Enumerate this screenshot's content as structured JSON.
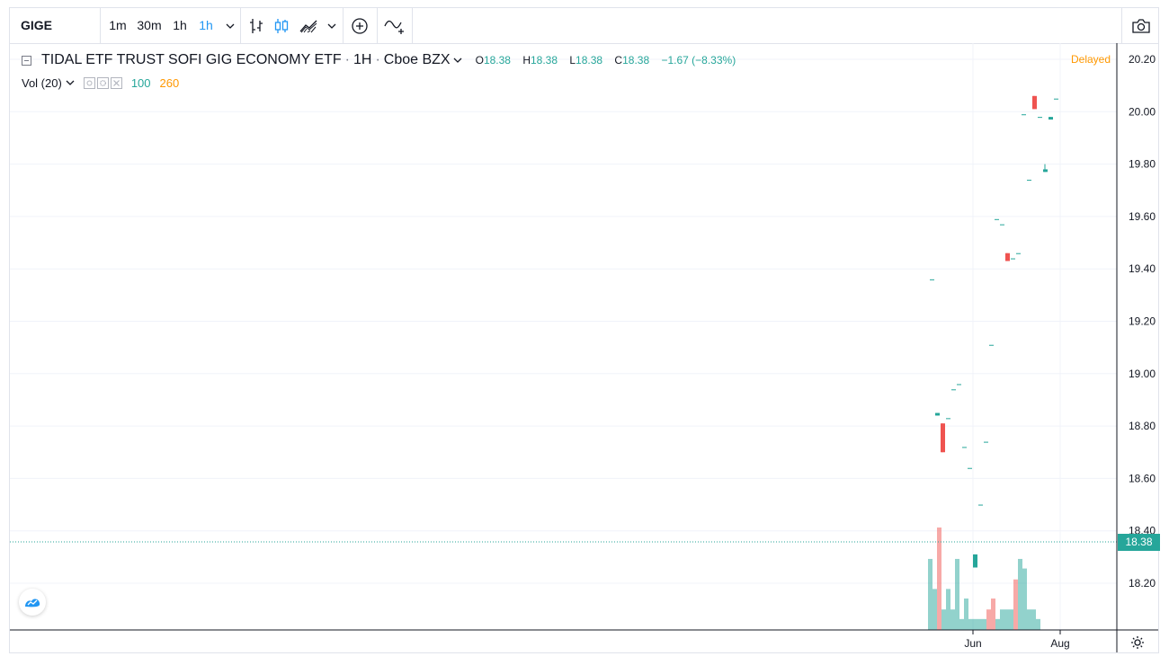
{
  "toolbar": {
    "symbol": "GIGE",
    "intervals": [
      "1m",
      "30m",
      "1h",
      "1h"
    ],
    "active_interval_index": 3
  },
  "legend": {
    "title": "TIDAL ETF TRUST SOFI GIG ECONOMY ETF",
    "interval": "1H",
    "exchange": "Cboe BZX",
    "o_label": "O",
    "o_value": "18.38",
    "h_label": "H",
    "h_value": "18.38",
    "l_label": "L",
    "l_value": "18.38",
    "c_label": "C",
    "c_value": "18.38",
    "change": "−1.67 (−8.33%)"
  },
  "volume_legend": {
    "label": "Vol (20)",
    "value_1": "100",
    "value_2": "260"
  },
  "status": "Delayed",
  "last_price": "18.38",
  "colors": {
    "up": "#26a69a",
    "down": "#ef5350",
    "accent": "#2196f3",
    "delayed": "#ff9800"
  },
  "chart_data": {
    "type": "candlestick",
    "y_ticks": [
      "20.20",
      "20.00",
      "19.80",
      "19.60",
      "19.40",
      "19.20",
      "19.00",
      "18.80",
      "18.60",
      "18.40",
      "18.20"
    ],
    "x_ticks": [
      "Jun",
      "Aug"
    ],
    "ylim": [
      18.05,
      20.25
    ],
    "grid": true,
    "candles": [
      {
        "o": 19.36,
        "c": 19.36,
        "h": 19.36,
        "l": 19.36
      },
      {
        "o": 18.84,
        "c": 18.85,
        "h": 18.85,
        "l": 18.84
      },
      {
        "o": 18.81,
        "c": 18.7,
        "h": 18.81,
        "l": 18.7
      },
      {
        "o": 18.83,
        "c": 18.83,
        "h": 18.83,
        "l": 18.83
      },
      {
        "o": 18.94,
        "c": 18.94,
        "h": 18.94,
        "l": 18.94
      },
      {
        "o": 18.96,
        "c": 18.96,
        "h": 18.96,
        "l": 18.96
      },
      {
        "o": 18.72,
        "c": 18.72,
        "h": 18.72,
        "l": 18.72
      },
      {
        "o": 18.64,
        "c": 18.64,
        "h": 18.64,
        "l": 18.64
      },
      {
        "o": 18.26,
        "c": 18.31,
        "h": 18.31,
        "l": 18.26
      },
      {
        "o": 18.5,
        "c": 18.5,
        "h": 18.5,
        "l": 18.5
      },
      {
        "o": 18.74,
        "c": 18.74,
        "h": 18.74,
        "l": 18.74
      },
      {
        "o": 19.11,
        "c": 19.11,
        "h": 19.11,
        "l": 19.11
      },
      {
        "o": 19.59,
        "c": 19.59,
        "h": 19.59,
        "l": 19.59
      },
      {
        "o": 19.57,
        "c": 19.57,
        "h": 19.57,
        "l": 19.57
      },
      {
        "o": 19.46,
        "c": 19.43,
        "h": 19.46,
        "l": 19.43
      },
      {
        "o": 19.44,
        "c": 19.44,
        "h": 19.44,
        "l": 19.44
      },
      {
        "o": 19.46,
        "c": 19.46,
        "h": 19.46,
        "l": 19.46
      },
      {
        "o": 19.99,
        "c": 19.99,
        "h": 19.99,
        "l": 19.99
      },
      {
        "o": 19.74,
        "c": 19.74,
        "h": 19.74,
        "l": 19.74
      },
      {
        "o": 20.06,
        "c": 20.01,
        "h": 20.06,
        "l": 20.01
      },
      {
        "o": 19.98,
        "c": 19.98,
        "h": 19.98,
        "l": 19.98
      },
      {
        "o": 19.77,
        "c": 19.78,
        "h": 19.8,
        "l": 19.77
      },
      {
        "o": 19.97,
        "c": 19.98,
        "h": 19.98,
        "l": 19.97
      },
      {
        "o": 20.05,
        "c": 20.05,
        "h": 20.05,
        "l": 20.05
      }
    ],
    "volume": [
      {
        "v": 260,
        "up": true
      },
      {
        "v": 150,
        "up": true
      },
      {
        "v": 375,
        "up": false
      },
      {
        "v": 75,
        "up": true
      },
      {
        "v": 150,
        "up": true
      },
      {
        "v": 75,
        "up": true
      },
      {
        "v": 260,
        "up": true
      },
      {
        "v": 40,
        "up": true
      },
      {
        "v": 115,
        "up": true
      },
      {
        "v": 40,
        "up": true
      },
      {
        "v": 40,
        "up": true
      },
      {
        "v": 40,
        "up": true
      },
      {
        "v": 40,
        "up": true
      },
      {
        "v": 75,
        "up": false
      },
      {
        "v": 115,
        "up": false
      },
      {
        "v": 40,
        "up": true
      },
      {
        "v": 75,
        "up": true
      },
      {
        "v": 75,
        "up": true
      },
      {
        "v": 75,
        "up": true
      },
      {
        "v": 185,
        "up": false
      },
      {
        "v": 260,
        "up": true
      },
      {
        "v": 225,
        "up": true
      },
      {
        "v": 75,
        "up": true
      },
      {
        "v": 75,
        "up": true
      },
      {
        "v": 40,
        "up": true
      }
    ]
  }
}
